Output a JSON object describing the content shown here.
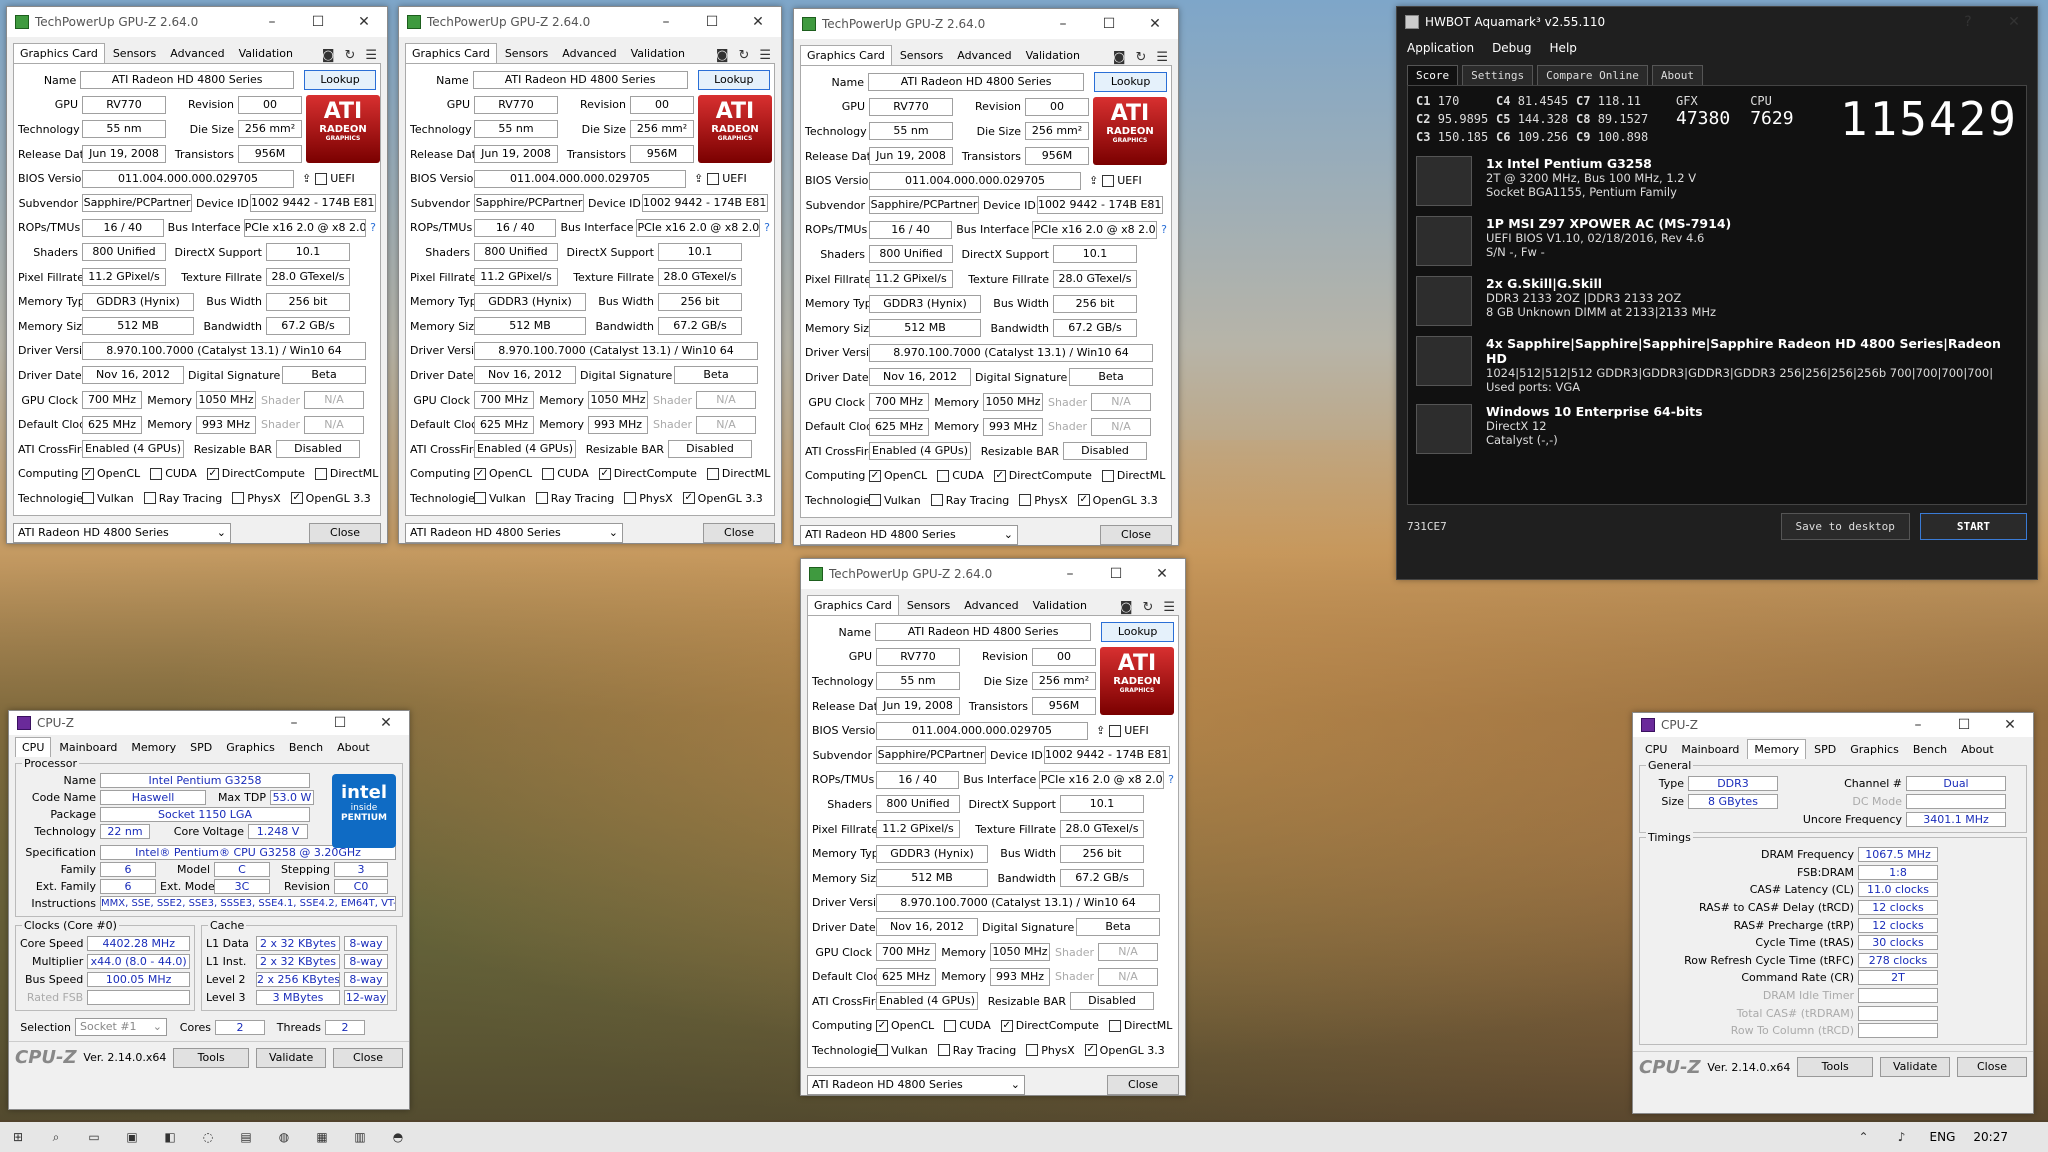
{
  "gpuz": {
    "title": "TechPowerUp GPU-Z 2.64.0",
    "tabs": [
      "Graphics Card",
      "Sensors",
      "Advanced",
      "Validation"
    ],
    "labels": {
      "name": "Name",
      "gpu": "GPU",
      "revision": "Revision",
      "technology": "Technology",
      "die_size": "Die Size",
      "release_date": "Release Date",
      "transistors": "Transistors",
      "bios": "BIOS Version",
      "uefi": "UEFI",
      "subvendor": "Subvendor",
      "device_id": "Device ID",
      "rops": "ROPs/TMUs",
      "bus_interface": "Bus Interface",
      "shaders": "Shaders",
      "directx": "DirectX Support",
      "pixel": "Pixel Fillrate",
      "texture": "Texture Fillrate",
      "mem_type": "Memory Type",
      "bus_width": "Bus Width",
      "mem_size": "Memory Size",
      "bandwidth": "Bandwidth",
      "driver_ver": "Driver Version",
      "driver_date": "Driver Date",
      "dig_sig": "Digital Signature",
      "gpu_clock": "GPU Clock",
      "memory": "Memory",
      "shader": "Shader",
      "default_clock": "Default Clock",
      "crossfire": "ATI CrossFire",
      "resizable_bar": "Resizable BAR",
      "computing": "Computing",
      "technologies": "Technologies"
    },
    "values": {
      "name": "ATI Radeon HD 4800 Series",
      "lookup": "Lookup",
      "gpu": "RV770",
      "revision": "00",
      "technology": "55 nm",
      "die_size": "256 mm²",
      "release_date": "Jun 19, 2008",
      "transistors": "956M",
      "bios": "011.004.000.000.029705",
      "subvendor": "Sapphire/PCPartner",
      "device_id": "1002 9442 - 174B E810",
      "rops": "16 / 40",
      "bus_interface": "PCIe x16 2.0 @ x8 2.0",
      "shaders": "800 Unified",
      "directx": "10.1",
      "pixel": "11.2 GPixel/s",
      "texture": "28.0 GTexel/s",
      "mem_type": "GDDR3 (Hynix)",
      "bus_width": "256 bit",
      "mem_size": "512 MB",
      "bandwidth": "67.2 GB/s",
      "driver_ver": "8.970.100.7000 (Catalyst 13.1) / Win10 64",
      "driver_date": "Nov 16, 2012",
      "dig_sig": "Beta",
      "gpu_clock": "700 MHz",
      "gpu_mem": "1050 MHz",
      "shader_na": "N/A",
      "def_clock": "625 MHz",
      "def_mem": "993 MHz",
      "crossfire": "Enabled (4 GPUs)",
      "resizable_bar": "Disabled",
      "select": "ATI Radeon HD 4800 Series",
      "close": "Close",
      "q": "?"
    },
    "computing": [
      "OpenCL",
      "CUDA",
      "DirectCompute",
      "DirectML"
    ],
    "technologies": [
      "Vulkan",
      "Ray Tracing",
      "PhysX",
      "OpenGL 3.3"
    ],
    "logo": {
      "l1": "ATI",
      "l2": "RADEON",
      "l3": "GRAPHICS"
    }
  },
  "cpuz1": {
    "title": "CPU-Z",
    "tabs": [
      "CPU",
      "Mainboard",
      "Memory",
      "SPD",
      "Graphics",
      "Bench",
      "About"
    ],
    "processor": "Processor",
    "l": {
      "name": "Name",
      "code": "Code Name",
      "tdp": "Max TDP",
      "package": "Package",
      "tech": "Technology",
      "voltage": "Core Voltage",
      "spec": "Specification",
      "family": "Family",
      "model": "Model",
      "stepping": "Stepping",
      "extfam": "Ext. Family",
      "extmodel": "Ext. Model",
      "revision": "Revision",
      "instr": "Instructions",
      "clocks": "Clocks (Core #0)",
      "cache": "Cache",
      "core_speed": "Core Speed",
      "mult": "Multiplier",
      "bus": "Bus Speed",
      "fsb": "Rated FSB",
      "l1d": "L1 Data",
      "l1i": "L1 Inst.",
      "l2": "Level 2",
      "l3": "Level 3",
      "selection": "Selection",
      "cores": "Cores",
      "threads": "Threads"
    },
    "v": {
      "name": "Intel Pentium G3258",
      "code": "Haswell",
      "tdp": "53.0 W",
      "package": "Socket 1150 LGA",
      "tech": "22 nm",
      "voltage": "1.248 V",
      "spec": "Intel® Pentium® CPU G3258 @ 3.20GHz",
      "family": "6",
      "model": "C",
      "stepping": "3",
      "extfam": "6",
      "extmodel": "3C",
      "revision": "C0",
      "instr": "MMX, SSE, SSE2, SSE3, SSSE3, SSE4.1, SSE4.2, EM64T, VT-x",
      "core_speed": "4402.28 MHz",
      "mult": "x44.0 (8.0 - 44.0)",
      "bus": "100.05 MHz",
      "l1d": "2 x 32 KBytes",
      "l1d_w": "8-way",
      "l1i": "2 x 32 KBytes",
      "l1i_w": "8-way",
      "l2": "2 x 256 KBytes",
      "l2_w": "8-way",
      "l3": "3 MBytes",
      "l3_w": "12-way",
      "socket": "Socket #1",
      "cores": "2",
      "threads": "2"
    },
    "footer": {
      "logo": "CPU-Z",
      "ver": "Ver. 2.14.0.x64",
      "tools": "Tools",
      "validate": "Validate",
      "close": "Close"
    },
    "intel": {
      "a": "intel",
      "b": "inside",
      "c": "PENTIUM"
    }
  },
  "cpuz2": {
    "title": "CPU-Z",
    "tabs": [
      "CPU",
      "Mainboard",
      "Memory",
      "SPD",
      "Graphics",
      "Bench",
      "About"
    ],
    "general": "General",
    "timings": "Timings",
    "l": {
      "type": "Type",
      "size": "Size",
      "channel": "Channel #",
      "dc": "DC Mode",
      "uncore": "Uncore Frequency",
      "dram": "DRAM Frequency",
      "fsbdram": "FSB:DRAM",
      "cl": "CAS# Latency (CL)",
      "trcd": "RAS# to CAS# Delay (tRCD)",
      "trp": "RAS# Precharge (tRP)",
      "tras": "Cycle Time (tRAS)",
      "trfc": "Row Refresh Cycle Time (tRFC)",
      "cr": "Command Rate (CR)",
      "idle": "DRAM Idle Timer",
      "trdram": "Total CAS# (tRDRAM)",
      "trcd2": "Row To Column (tRCD)"
    },
    "v": {
      "type": "DDR3",
      "size": "8 GBytes",
      "channel": "Dual",
      "uncore": "3401.1 MHz",
      "dram": "1067.5 MHz",
      "fsbdram": "1:8",
      "cl": "11.0 clocks",
      "trcd": "12 clocks",
      "trp": "12 clocks",
      "tras": "30 clocks",
      "trfc": "278 clocks",
      "cr": "2T"
    },
    "footer": {
      "logo": "CPU-Z",
      "ver": "Ver. 2.14.0.x64",
      "tools": "Tools",
      "validate": "Validate",
      "close": "Close"
    }
  },
  "aquamark": {
    "title": "HWBOT Aquamark³ v2.55.110",
    "menu": [
      "Application",
      "Debug",
      "Help"
    ],
    "tabs": [
      "Score",
      "Settings",
      "Compare Online",
      "About"
    ],
    "c": [
      [
        "C1",
        "170"
      ],
      [
        "C2",
        "95.9895"
      ],
      [
        "C3",
        "150.185"
      ],
      [
        "C4",
        "81.4545"
      ],
      [
        "C5",
        "144.328"
      ],
      [
        "C6",
        "109.256"
      ],
      [
        "C7",
        "118.11"
      ],
      [
        "C8",
        "89.1527"
      ],
      [
        "C9",
        "100.898"
      ]
    ],
    "gfx_label": "GFX",
    "gfx": "47380",
    "cpu_label": "CPU",
    "cpu": "7629",
    "score": "115429",
    "items": [
      {
        "icon": "cpu-chip-icon",
        "t1": "1x Intel Pentium G3258",
        "t2": "2T @ 3200 MHz, Bus 100 MHz, 1.2 V",
        "t3": "Socket BGA1155, Pentium Family"
      },
      {
        "icon": "motherboard-icon",
        "t1": "1P MSI Z97 XPOWER AC (MS-7914)",
        "t2": "UEFI BIOS V1.10, 02/18/2016, Rev 4.6",
        "t3": "S/N -, Fw -"
      },
      {
        "icon": "ram-icon",
        "t1": "2x G.Skill|G.Skill",
        "t2": "DDR3 2133 2OZ     |DDR3 2133 2OZ",
        "t3": "8 GB Unknown DIMM at 2133|2133 MHz"
      },
      {
        "icon": "graphics-card-icon",
        "t1": "4x Sapphire|Sapphire|Sapphire|Sapphire Radeon HD 4800 Series|Radeon HD",
        "t2": "1024|512|512|512 GDDR3|GDDR3|GDDR3|GDDR3 256|256|256|256b 700|700|700|700|",
        "t3": "Used ports: VGA"
      },
      {
        "icon": "windows-logo-icon",
        "t1": "Windows 10 Enterprise 64-bits",
        "t2": "DirectX 12",
        "t3": "Catalyst (-,-)"
      }
    ],
    "code": "731CE7",
    "save": "Save to desktop",
    "start": "START"
  },
  "taskbar": {
    "lang": "ENG",
    "time": "20:27"
  }
}
